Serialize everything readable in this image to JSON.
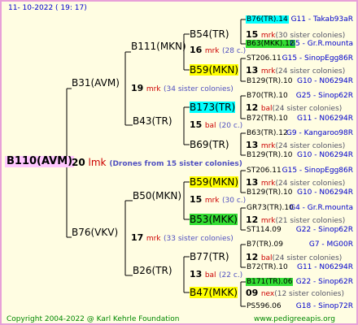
{
  "header": {
    "date": "11- 10-2022 ( 19: 17)"
  },
  "root": {
    "name": "B110(AVM)",
    "count": "20",
    "abbr": "lmk",
    "note": "(Drones from 15 sister colonies)"
  },
  "gen1": [
    {
      "name": "B31(AVM)",
      "count": "19",
      "abbr": "mrk",
      "note": "(34 sister colonies)"
    },
    {
      "name": "B76(VKV)",
      "count": "17",
      "abbr": "mrk",
      "note": "(33 sister colonies)"
    }
  ],
  "gen2": [
    {
      "name": "B111(MKN)",
      "count": "16",
      "abbr": "mrk",
      "note": "(28 c.)"
    },
    {
      "name": "B43(TR)",
      "count": "15",
      "abbr": "bal",
      "note": "(20 c.)"
    },
    {
      "name": "B50(MKN)",
      "count": "15",
      "abbr": "mrk",
      "note": "(30 c.)"
    },
    {
      "name": "B26(TR)",
      "count": "13",
      "abbr": "bal",
      "note": "(22 c.)"
    }
  ],
  "gen3": [
    {
      "name": "B54(TR)",
      "count": "15",
      "abbr": "mrk",
      "note": "(30 sister colonies)",
      "hl": ""
    },
    {
      "name": "B59(MKN)",
      "count": "13",
      "abbr": "mrk",
      "note": "(24 sister colonies)",
      "hl": "yellow"
    },
    {
      "name": "B173(TR)",
      "count": "12",
      "abbr": "bal",
      "note": "(24 sister colonies)",
      "hl": "cyan"
    },
    {
      "name": "B69(TR)",
      "count": "13",
      "abbr": "mrk",
      "note": "(24 sister colonies)",
      "hl": ""
    },
    {
      "name": "B59(MKN)",
      "count": "13",
      "abbr": "mrk",
      "note": "(24 sister colonies)",
      "hl": "yellow"
    },
    {
      "name": "B53(MKK)",
      "count": "12",
      "abbr": "mrk",
      "note": "(21 sister colonies)",
      "hl": "green"
    },
    {
      "name": "B77(TR)",
      "count": "12",
      "abbr": "bal",
      "note": "(24 sister colonies)",
      "hl": ""
    },
    {
      "name": "B47(MKK)",
      "count": "09",
      "abbr": "nex",
      "note": "(12 sister colonies)",
      "hl": "yellow"
    }
  ],
  "gen4": [
    {
      "name": "B76(TR).14",
      "loc": "G11 - Takab93aR",
      "hl": "cyan"
    },
    {
      "name": "B63(MKK).12",
      "loc": "G5 - Gr.R.mounta",
      "hl": "green"
    },
    {
      "name": "ST206.11",
      "loc": "G15 - SinopEgg86R",
      "hl": ""
    },
    {
      "name": "B129(TR).10",
      "loc": "G10 - N06294R",
      "hl": ""
    },
    {
      "name": "B70(TR).10",
      "loc": "G25 - Sinop62R",
      "hl": ""
    },
    {
      "name": "B72(TR).10",
      "loc": "G11 - N06294R",
      "hl": ""
    },
    {
      "name": "B63(TR).12",
      "loc": "G9 - Kangaroo98R",
      "hl": ""
    },
    {
      "name": "B129(TR).10",
      "loc": "G10 - N06294R",
      "hl": ""
    },
    {
      "name": "ST206.11",
      "loc": "G15 - SinopEgg86R",
      "hl": ""
    },
    {
      "name": "B129(TR).10",
      "loc": "G10 - N06294R",
      "hl": ""
    },
    {
      "name": "GR73(TR).10",
      "loc": "G4 - Gr.R.mounta",
      "hl": ""
    },
    {
      "name": "ST114.09",
      "loc": "G22 - Sinop62R",
      "hl": ""
    },
    {
      "name": "B7(TR).09",
      "loc": "G7 - MG00R",
      "hl": ""
    },
    {
      "name": "B72(TR).10",
      "loc": "G11 - N06294R",
      "hl": ""
    },
    {
      "name": "B171(TR).06",
      "loc": "G22 - Sinop62R",
      "hl": "green"
    },
    {
      "name": "PS596.06",
      "loc": "G18 - Sinop72R",
      "hl": ""
    }
  ],
  "footer": {
    "copyright": "Copyright 2004-2022 @ Karl Kehrle Foundation",
    "site": "www.pedigreeapis.org"
  }
}
